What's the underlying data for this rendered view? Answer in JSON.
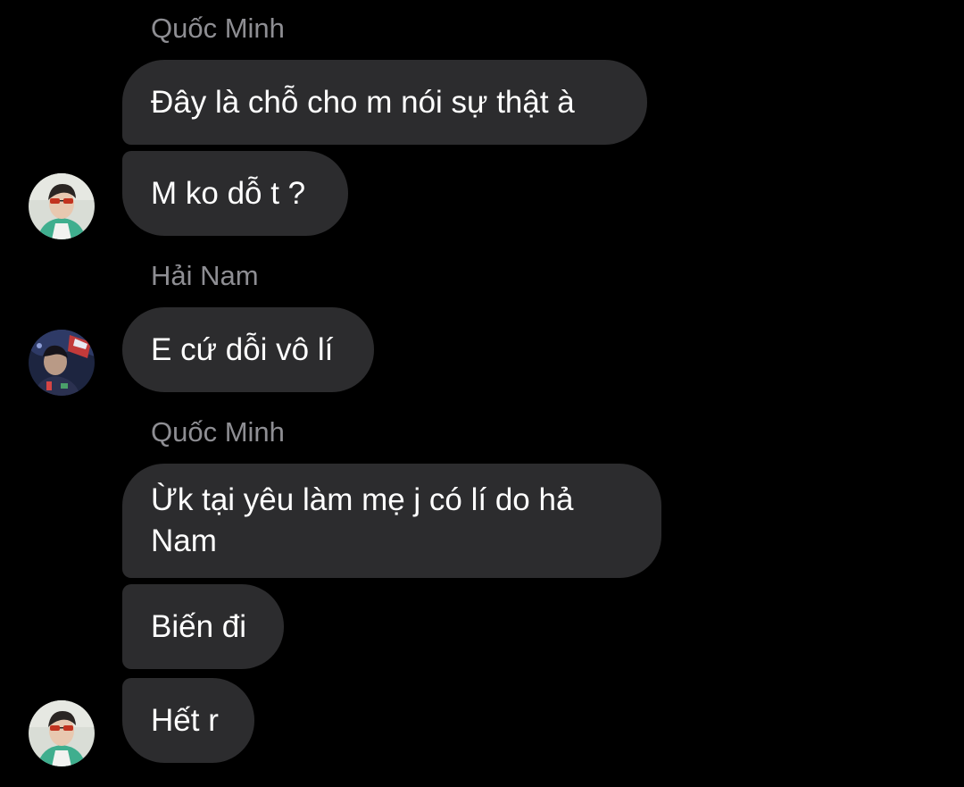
{
  "colors": {
    "background": "#000000",
    "bubble": "#2c2c2e",
    "bubble_text": "#ffffff",
    "sender_name": "#8e8e93"
  },
  "messages": [
    {
      "sender": "Quốc Minh"
    },
    {
      "text": "Đây là chỗ cho m nói sự thật à"
    },
    {
      "text": "M ko dỗ t ?",
      "avatar": "quoc-minh-avatar"
    },
    {
      "sender": "Hải Nam"
    },
    {
      "text": "E cứ dỗi vô lí",
      "avatar": "hai-nam-avatar"
    },
    {
      "sender": "Quốc Minh"
    },
    {
      "text": "Ừk tại yêu làm mẹ j có lí do hả Nam"
    },
    {
      "text": "Biến đi"
    },
    {
      "text": "Hết r",
      "avatar": "quoc-minh-avatar"
    }
  ]
}
